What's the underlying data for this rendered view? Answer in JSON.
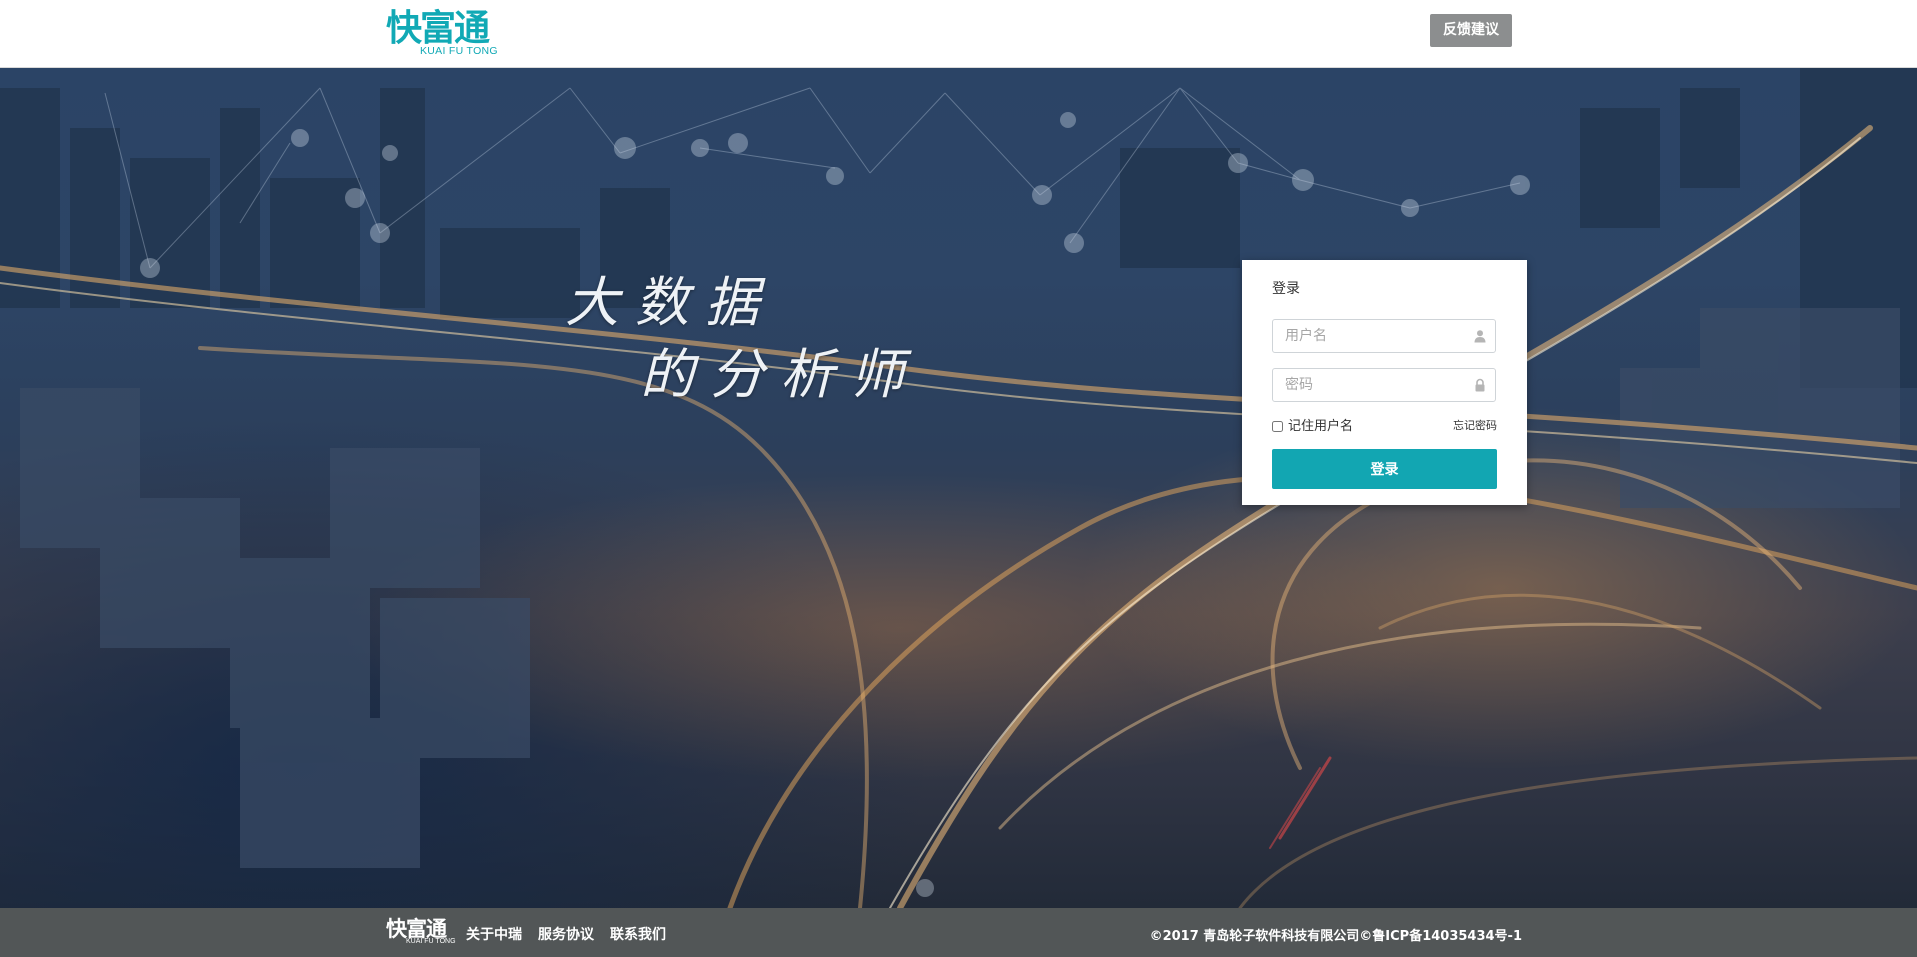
{
  "header": {
    "logo_cn": "快富通",
    "logo_en": "KUAI FU TONG",
    "feedback_label": "反馈建议"
  },
  "hero": {
    "slogan_line1": "大数据",
    "slogan_line2": "的分析师"
  },
  "login": {
    "title": "登录",
    "username_placeholder": "用户名",
    "password_placeholder": "密码",
    "username_icon": "user-icon",
    "password_icon": "lock-icon",
    "remember_label": "记住用户名",
    "remember_checked": false,
    "forgot_label": "忘记密码",
    "submit_label": "登录"
  },
  "footer": {
    "logo_cn": "快富通",
    "logo_en": "KUAI FU TONG",
    "links": [
      "关于中瑞",
      "服务协议",
      "联系我们"
    ],
    "copyright": "©2017 青岛轮子软件科技有限公司©鲁ICP备14035434号-1"
  },
  "colors": {
    "brand": "#11a9b5",
    "login_button": "#12a6b2",
    "feedback_button": "#8c8e8f",
    "footer_bg": "#525657"
  }
}
